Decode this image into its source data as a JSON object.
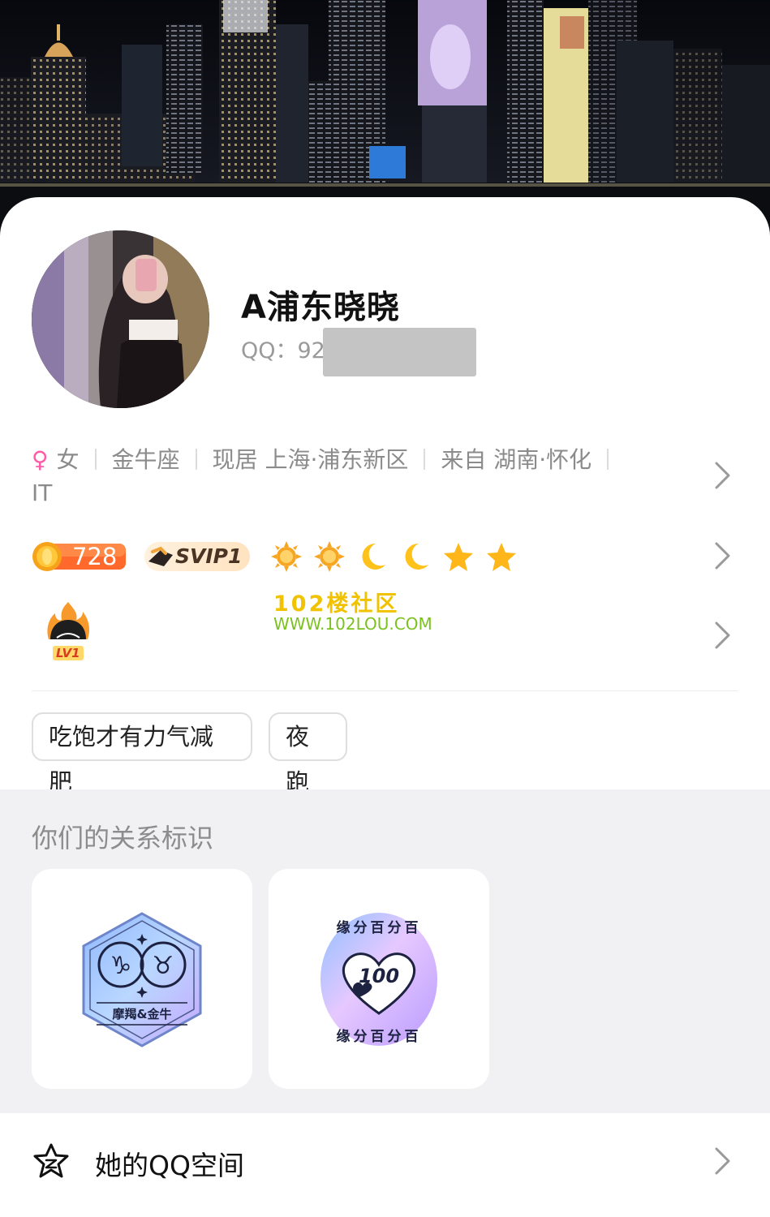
{
  "profile": {
    "nickname": "A浦东晓晓",
    "qq_label": "QQ：92"
  },
  "info": {
    "gender_icon": "female-icon",
    "gender": "女",
    "zodiac": "金牛座",
    "residence": "现居 上海·浦东新区",
    "hometown": "来自 湖南·怀化",
    "profession": "IT"
  },
  "badges": {
    "qq_level_score": "728",
    "svip": "SVIP1",
    "level_icons": [
      "sun-icon",
      "sun-icon",
      "moon-icon",
      "moon-icon",
      "star-icon",
      "star-icon"
    ],
    "game_level": "LV1"
  },
  "watermark": {
    "line1": "102楼社区",
    "line2": "WWW.102LOU.COM"
  },
  "tags": [
    "吃饱才有力气减肥",
    "夜跑"
  ],
  "relation": {
    "title": "你们的关系标识",
    "cards": [
      {
        "label": "摩羯&金牛",
        "icon": "capricorn-taurus-badge-icon"
      },
      {
        "text_ring": "缘分百分百",
        "value": "100",
        "icon": "fate-100-badge-icon"
      }
    ]
  },
  "space": {
    "label": "她的QQ空间"
  },
  "colors": {
    "accent_pink": "#ff5aa8",
    "muted_text": "#8b8b8b",
    "section_bg": "#f1f1f3"
  }
}
